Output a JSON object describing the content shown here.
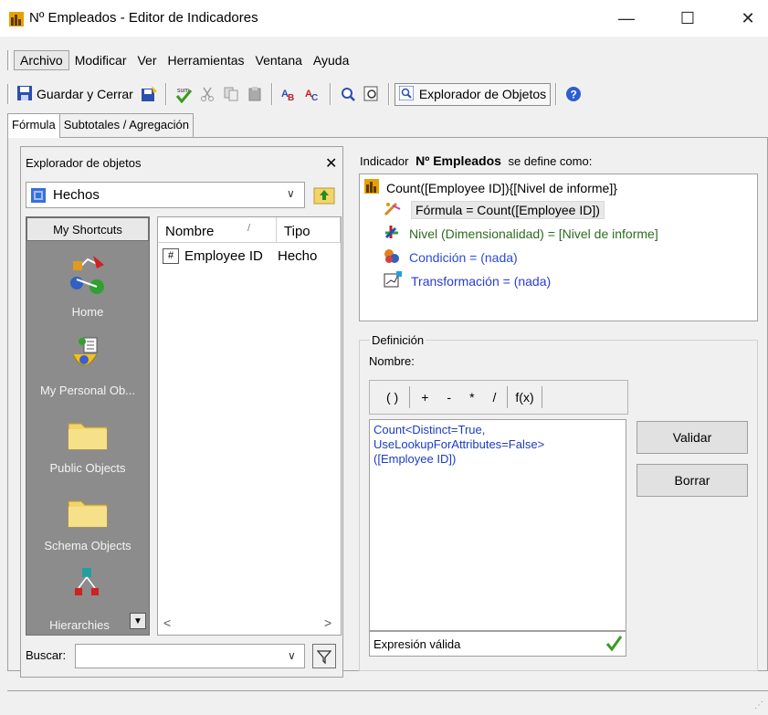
{
  "window": {
    "title": "Nº Empleados - Editor de Indicadores",
    "min_glyph": "—",
    "max_glyph": "☐",
    "close_glyph": "✕"
  },
  "menu": [
    "Archivo",
    "Modificar",
    "Ver",
    "Herramientas",
    "Ventana",
    "Ayuda"
  ],
  "toolbar": {
    "save_close": "Guardar y Cerrar",
    "object_explorer": "Explorador de Objetos",
    "icons": [
      "save-icon",
      "save-as-icon",
      "validate-icon",
      "cut-icon",
      "copy-icon",
      "paste-icon",
      "find-icon",
      "replace-icon",
      "zoom-icon",
      "preview-icon",
      "object-explorer-icon",
      "help-icon"
    ]
  },
  "tabs": [
    "Fórmula",
    "Subtotales / Agregación"
  ],
  "explorer": {
    "title": "Explorador de objetos",
    "close_glyph": "✕",
    "combo_value": "Hechos",
    "shortcuts_header": "My Shortcuts",
    "shortcuts": [
      "Home",
      "My Personal Ob...",
      "Public Objects",
      "Schema Objects",
      "Hierarchies"
    ],
    "columns": [
      "Nombre",
      "Tipo"
    ],
    "rows": [
      {
        "name": "Employee ID",
        "type": "Hecho"
      }
    ],
    "search_label": "Buscar:",
    "search_value": ""
  },
  "definition": {
    "heading_prefix": "Indicador",
    "heading_name": "Nº Empleados",
    "heading_suffix": "se define como:",
    "root": "Count([Employee ID]){[Nivel de informe]}",
    "formula": "Fórmula = Count([Employee ID])",
    "level": "Nivel (Dimensionalidad) = [Nivel de informe]",
    "condition": "Condición = (nada)",
    "transformation": "Transformación = (nada)",
    "colors": {
      "level": "#2e6b1f",
      "condition": "#2a4ad8",
      "transformation": "#2a3ad8"
    }
  },
  "editor": {
    "group_title": "Definición",
    "name_label": "Nombre:",
    "operators": [
      "( )",
      "+",
      "-",
      "*",
      "/",
      "f(x)"
    ],
    "expression": "Count<Distinct=True,\nUseLookupForAttributes=False>\n([Employee ID])",
    "status": "Expresión válida",
    "validate_button": "Validar",
    "clear_button": "Borrar"
  }
}
